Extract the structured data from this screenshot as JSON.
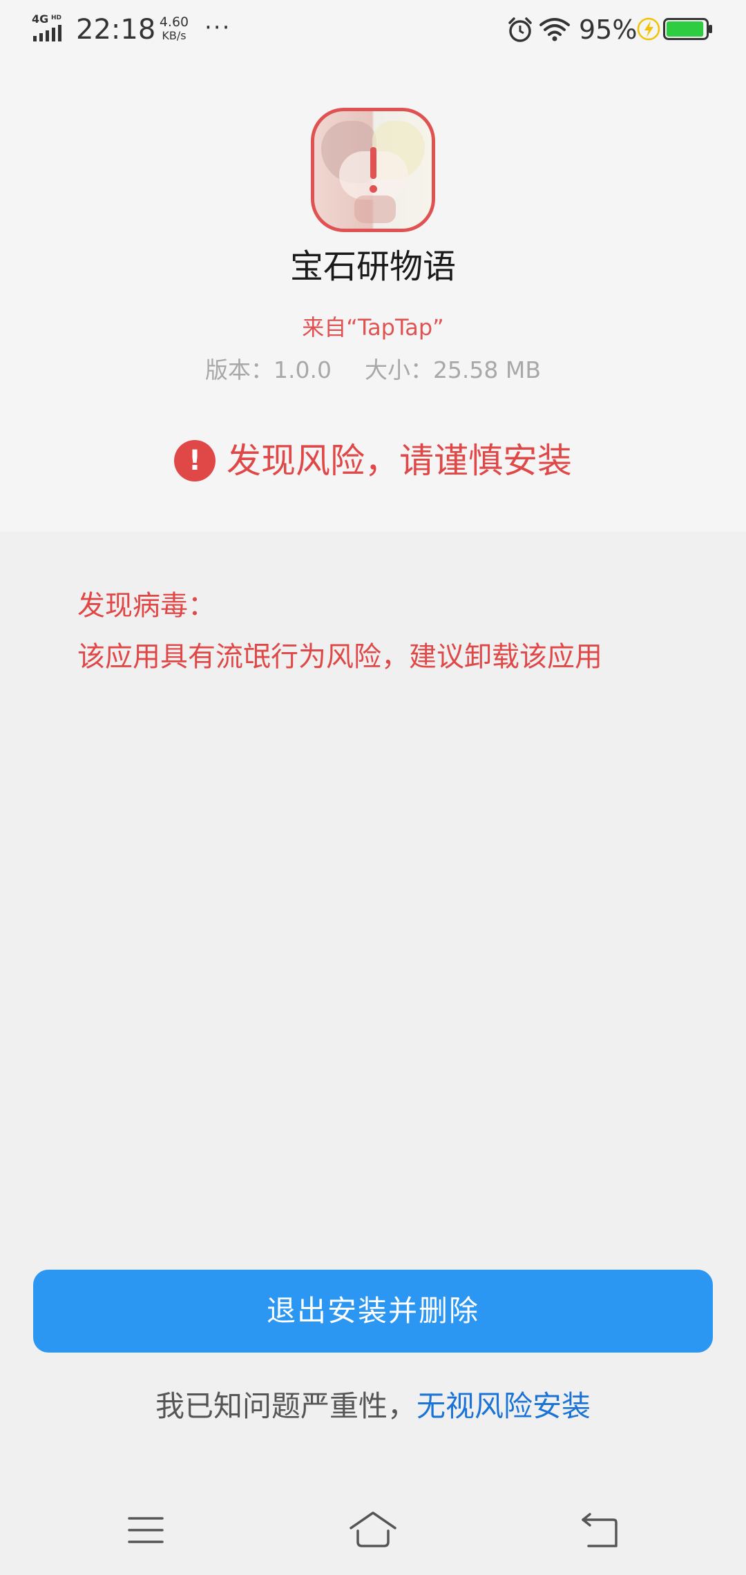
{
  "status_bar": {
    "network": "4G",
    "network_hd": "HD",
    "time": "22:18",
    "speed_value": "4.60",
    "speed_unit": "KB/s",
    "more": "···",
    "battery_percent": "95%",
    "battery_level": 0.95,
    "icons": [
      "signal-icon",
      "alarm-icon",
      "wifi-icon",
      "charging-bolt-icon",
      "battery-icon"
    ]
  },
  "app": {
    "name": "宝石研物语",
    "source": "来自“TapTap”",
    "version": "版本：1.0.0",
    "size": "大小：25.58 MB"
  },
  "risk": {
    "icon_text": "!",
    "title": "发现风险，请谨慎安装"
  },
  "details": {
    "heading": "发现病毒：",
    "message": "该应用具有流氓行为风险，建议卸载该应用"
  },
  "actions": {
    "exit_delete_label": "退出安装并删除",
    "ignore_prefix": "我已知问题严重性，",
    "ignore_link": "无视风险安装"
  },
  "nav": {
    "icons": [
      "menu-icon",
      "home-icon",
      "back-icon"
    ]
  },
  "colors": {
    "danger": "#e04848",
    "primary": "#2b97f2",
    "link": "#1a73d6",
    "background": "#f0f0f0",
    "header_background": "#f5f5f5"
  }
}
